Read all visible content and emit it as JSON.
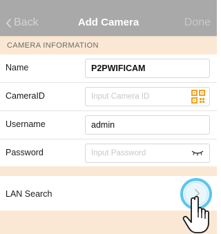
{
  "nav": {
    "back_label": "Back",
    "title": "Add Camera",
    "done_label": "Done"
  },
  "section": {
    "header": "CAMERA INFORMATION"
  },
  "fields": [
    {
      "label": "Name",
      "value": "P2PWIFICAM",
      "placeholder": ""
    },
    {
      "label": "CameraID",
      "value": "",
      "placeholder": "Input Camera ID"
    },
    {
      "label": "Username",
      "value": "admin",
      "placeholder": ""
    },
    {
      "label": "Password",
      "value": "",
      "placeholder": "Input Password"
    }
  ],
  "lan": {
    "label": "LAN Search"
  },
  "icons": {
    "back": "chevron-left-icon",
    "qr": "qr-code-icon",
    "eye": "eye-closed-icon",
    "chevron": "chevron-right-icon",
    "hand": "hand-pointer-icon"
  },
  "colors": {
    "navbar": "#a9a9a9",
    "section_band": "#fbe8d4",
    "highlight_ring": "#59c7ee",
    "qr": "#f0a020"
  }
}
